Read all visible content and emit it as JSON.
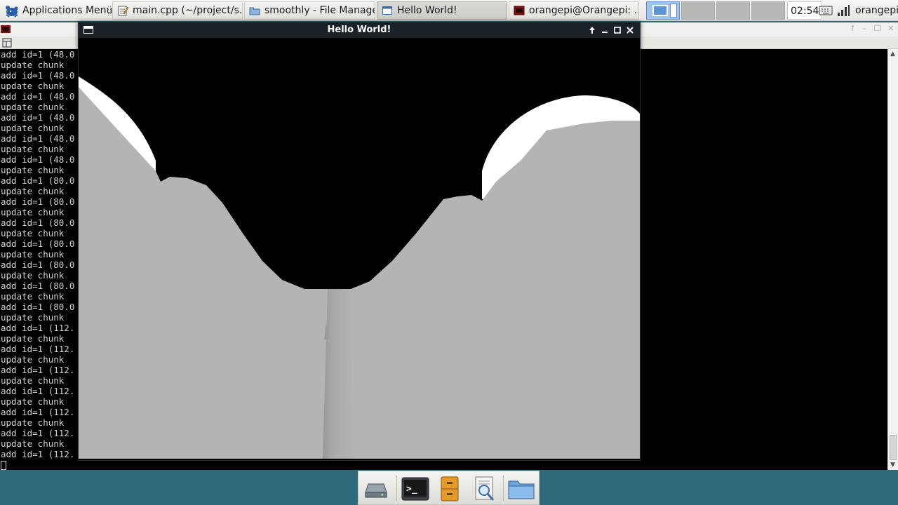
{
  "top_panel": {
    "apps_menu_label": "Applications Menu",
    "tasks": [
      {
        "label": "main.cpp (~/project/s...",
        "icon": "text-editor-icon",
        "active": false
      },
      {
        "label": "smoothly - File Manager",
        "icon": "folder-icon",
        "active": false
      },
      {
        "label": "Hello World!",
        "icon": "window-icon",
        "active": true
      },
      {
        "label": "orangepi@Orangepi: ...",
        "icon": "terminal-icon",
        "active": false
      }
    ],
    "clock": "02:54",
    "user": "orangepi",
    "colors": {
      "active_workspace": "#9fc4ef"
    }
  },
  "terminal": {
    "lines": [
      "add id=1 (48.0",
      "update chunk",
      "add id=1 (48.0",
      "update chunk",
      "add id=1 (48.0",
      "update chunk",
      "add id=1 (48.0",
      "update chunk",
      "add id=1 (48.0",
      "update chunk",
      "add id=1 (48.0",
      "update chunk",
      "add id=1 (80.0",
      "update chunk",
      "add id=1 (80.0",
      "update chunk",
      "add id=1 (80.0",
      "update chunk",
      "add id=1 (80.0",
      "update chunk",
      "add id=1 (80.0",
      "update chunk",
      "add id=1 (80.0",
      "update chunk",
      "add id=1 (80.0",
      "update chunk",
      "add id=1 (112.",
      "update chunk",
      "add id=1 (112.",
      "update chunk",
      "add id=1 (112.",
      "update chunk",
      "add id=1 (112.",
      "update chunk",
      "add id=1 (112.",
      "update chunk",
      "add id=1 (112.",
      "update chunk",
      "add id=1 (112."
    ]
  },
  "hello_window": {
    "title": "Hello World!",
    "scene_colors": {
      "sky": "#000000",
      "snow": "#ffffff",
      "terrain": "#b4b4b4"
    }
  },
  "dock": {
    "items": [
      "drive-icon",
      "terminal-icon",
      "file-cabinet-icon",
      "search-icon",
      "folder-icon"
    ]
  }
}
